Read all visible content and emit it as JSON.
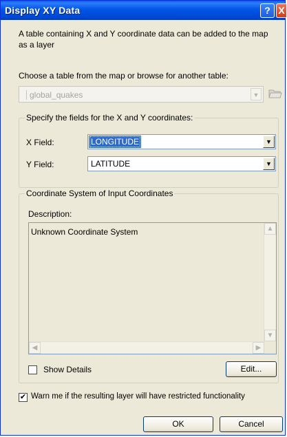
{
  "window": {
    "title": "Display XY Data",
    "help_glyph": "?",
    "close_glyph": "X"
  },
  "intro": {
    "text": "A table containing X and Y coordinate data can be added to the map as a layer"
  },
  "table_select": {
    "label": "Choose a table from the map or browse for another table:",
    "value": "global_quakes",
    "browse_icon": "open-folder-icon"
  },
  "xy_fields": {
    "legend": "Specify the fields for the X and Y coordinates:",
    "x_label": "X Field:",
    "x_value": "LONGITUDE",
    "y_label": "Y Field:",
    "y_value": "LATITUDE"
  },
  "coord_system": {
    "legend": "Coordinate System of Input Coordinates",
    "description_label": "Description:",
    "description": "Unknown Coordinate System",
    "show_details_label": "Show Details",
    "show_details_checked": false,
    "edit_label": "Edit..."
  },
  "warning": {
    "label": "Warn me if the resulting layer will have restricted functionality",
    "checked": true
  },
  "buttons": {
    "ok": "OK",
    "cancel": "Cancel"
  },
  "colors": {
    "titlebar": "#0055e5",
    "dialog_bg": "#ece9d8",
    "selection": "#316ac5"
  }
}
